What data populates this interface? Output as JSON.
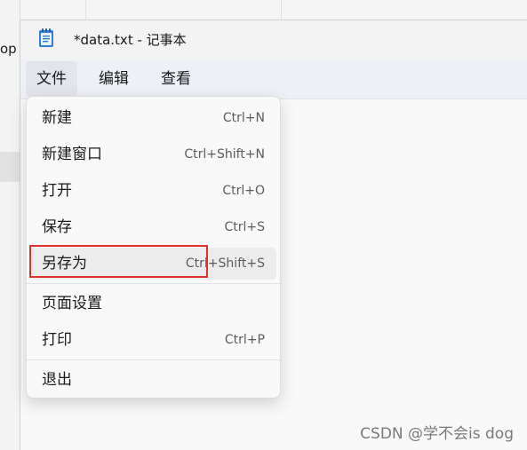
{
  "background": {
    "partial_text": "op"
  },
  "window": {
    "title": "*data.txt - 记事本",
    "icon": "notepad-icon"
  },
  "menubar": {
    "file": "文件",
    "edit": "编辑",
    "view": "查看"
  },
  "file_menu": {
    "items": [
      {
        "label": "新建",
        "shortcut": "Ctrl+N"
      },
      {
        "label": "新建窗口",
        "shortcut": "Ctrl+Shift+N"
      },
      {
        "label": "打开",
        "shortcut": "Ctrl+O"
      },
      {
        "label": "保存",
        "shortcut": "Ctrl+S"
      },
      {
        "label": "另存为",
        "shortcut": "Ctrl+Shift+S"
      },
      {
        "label": "页面设置",
        "shortcut": ""
      },
      {
        "label": "打印",
        "shortcut": "Ctrl+P"
      },
      {
        "label": "退出",
        "shortcut": ""
      }
    ],
    "highlighted_item": "另存为",
    "highlight_color": "#e0312b"
  },
  "watermark": "CSDN @学不会is dog"
}
